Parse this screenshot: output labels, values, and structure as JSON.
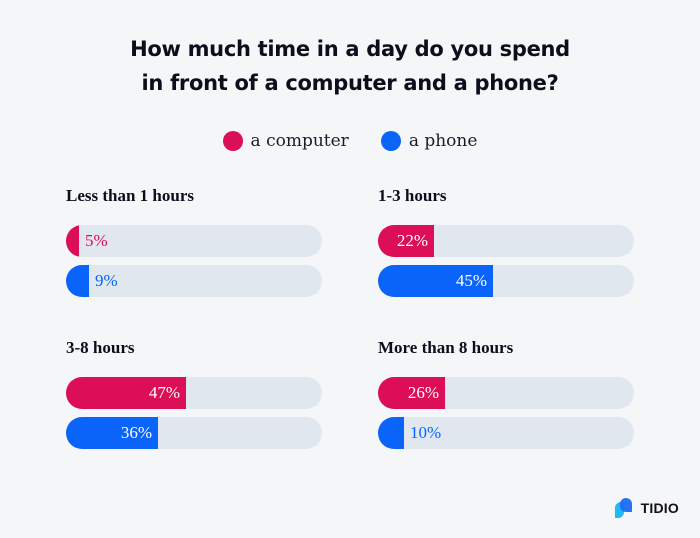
{
  "chart_data": {
    "type": "bar",
    "orientation": "horizontal",
    "title": "How much time in a day do you spend in front of a computer and a phone?",
    "title_lines": [
      "How much time in a day do you spend",
      "in front of a computer and a phone?"
    ],
    "xlabel": "",
    "ylabel": "",
    "xlim": [
      0,
      100
    ],
    "grid": false,
    "legend_position": "top-center",
    "value_suffix": "%",
    "series": [
      {
        "name": "a computer",
        "color": "#dc0e55",
        "values": [
          5,
          22,
          47,
          26
        ]
      },
      {
        "name": "a phone",
        "color": "#0a64f9",
        "values": [
          9,
          45,
          36,
          10
        ]
      }
    ],
    "categories": [
      "Less than 1 hours",
      "1-3 hours",
      "3-8 hours",
      "More than 8 hours"
    ]
  },
  "colors": {
    "background": "#f5f6f8",
    "track": "#e1e7ef",
    "computer": "#dc0e55",
    "phone": "#0a64f9"
  },
  "brand": {
    "name": "TIDIO",
    "icon": "tidio-logo-icon"
  }
}
